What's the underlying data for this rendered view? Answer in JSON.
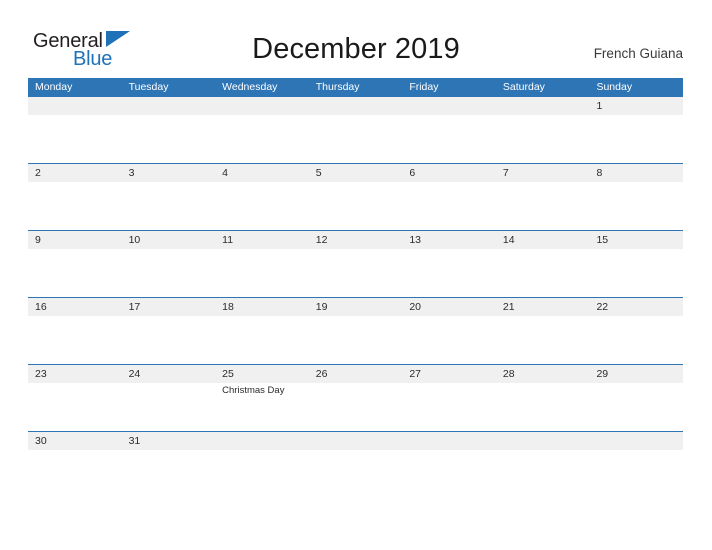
{
  "brand": {
    "name_part1": "General",
    "name_part2": "Blue",
    "triangle_icon": "triangle-icon",
    "color_dark": "#231f20",
    "color_blue": "#1f72b8"
  },
  "header": {
    "title": "December 2019",
    "location": "French Guiana"
  },
  "calendar": {
    "accent_color": "#2e75b6",
    "band_color": "#f0f0f0",
    "weekdays": [
      "Monday",
      "Tuesday",
      "Wednesday",
      "Thursday",
      "Friday",
      "Saturday",
      "Sunday"
    ],
    "weeks": [
      {
        "days": [
          {
            "num": "",
            "event": ""
          },
          {
            "num": "",
            "event": ""
          },
          {
            "num": "",
            "event": ""
          },
          {
            "num": "",
            "event": ""
          },
          {
            "num": "",
            "event": ""
          },
          {
            "num": "",
            "event": ""
          },
          {
            "num": "1",
            "event": ""
          }
        ]
      },
      {
        "days": [
          {
            "num": "2",
            "event": ""
          },
          {
            "num": "3",
            "event": ""
          },
          {
            "num": "4",
            "event": ""
          },
          {
            "num": "5",
            "event": ""
          },
          {
            "num": "6",
            "event": ""
          },
          {
            "num": "7",
            "event": ""
          },
          {
            "num": "8",
            "event": ""
          }
        ]
      },
      {
        "days": [
          {
            "num": "9",
            "event": ""
          },
          {
            "num": "10",
            "event": ""
          },
          {
            "num": "11",
            "event": ""
          },
          {
            "num": "12",
            "event": ""
          },
          {
            "num": "13",
            "event": ""
          },
          {
            "num": "14",
            "event": ""
          },
          {
            "num": "15",
            "event": ""
          }
        ]
      },
      {
        "days": [
          {
            "num": "16",
            "event": ""
          },
          {
            "num": "17",
            "event": ""
          },
          {
            "num": "18",
            "event": ""
          },
          {
            "num": "19",
            "event": ""
          },
          {
            "num": "20",
            "event": ""
          },
          {
            "num": "21",
            "event": ""
          },
          {
            "num": "22",
            "event": ""
          }
        ]
      },
      {
        "days": [
          {
            "num": "23",
            "event": ""
          },
          {
            "num": "24",
            "event": ""
          },
          {
            "num": "25",
            "event": "Christmas Day"
          },
          {
            "num": "26",
            "event": ""
          },
          {
            "num": "27",
            "event": ""
          },
          {
            "num": "28",
            "event": ""
          },
          {
            "num": "29",
            "event": ""
          }
        ]
      },
      {
        "days": [
          {
            "num": "30",
            "event": ""
          },
          {
            "num": "31",
            "event": ""
          },
          {
            "num": "",
            "event": ""
          },
          {
            "num": "",
            "event": ""
          },
          {
            "num": "",
            "event": ""
          },
          {
            "num": "",
            "event": ""
          },
          {
            "num": "",
            "event": ""
          }
        ]
      }
    ]
  }
}
